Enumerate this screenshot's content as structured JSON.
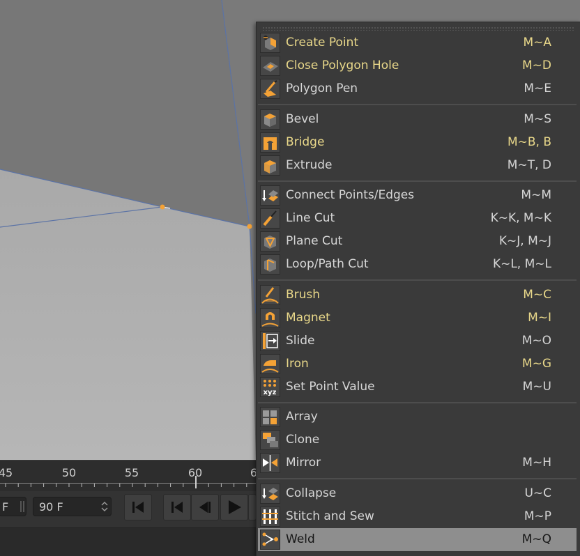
{
  "colors": {
    "accent_orange": "#f4a236",
    "highlight_text": "#e9d88a",
    "menu_bg": "#3a3a3a",
    "selected_bg": "#8e8e8e",
    "edge_blue": "#5b73a6"
  },
  "timeline": {
    "ticks": [
      "45",
      "50",
      "55",
      "60",
      "6"
    ]
  },
  "transport": {
    "start_suffix": "F",
    "end_frame": "90 F"
  },
  "menu": {
    "items": [
      {
        "label": "Create Point",
        "shortcut": "M~A",
        "icon": "create-point-icon",
        "highlight": true
      },
      {
        "label": "Close Polygon Hole",
        "shortcut": "M~D",
        "icon": "close-polygon-hole-icon",
        "highlight": true
      },
      {
        "label": "Polygon Pen",
        "shortcut": "M~E",
        "icon": "polygon-pen-icon",
        "highlight": false
      },
      {
        "label": "Bevel",
        "shortcut": "M~S",
        "icon": "bevel-icon",
        "highlight": false
      },
      {
        "label": "Bridge",
        "shortcut": "M~B, B",
        "icon": "bridge-icon",
        "highlight": true
      },
      {
        "label": "Extrude",
        "shortcut": "M~T, D",
        "icon": "extrude-icon",
        "highlight": false
      },
      {
        "label": "Connect Points/Edges",
        "shortcut": "M~M",
        "icon": "connect-points-icon",
        "highlight": false
      },
      {
        "label": "Line Cut",
        "shortcut": "K~K, M~K",
        "icon": "line-cut-icon",
        "highlight": false
      },
      {
        "label": "Plane Cut",
        "shortcut": "K~J, M~J",
        "icon": "plane-cut-icon",
        "highlight": false
      },
      {
        "label": "Loop/Path Cut",
        "shortcut": "K~L, M~L",
        "icon": "loop-path-cut-icon",
        "highlight": false
      },
      {
        "label": "Brush",
        "shortcut": "M~C",
        "icon": "brush-icon",
        "highlight": true
      },
      {
        "label": "Magnet",
        "shortcut": "M~I",
        "icon": "magnet-icon",
        "highlight": true
      },
      {
        "label": "Slide",
        "shortcut": "M~O",
        "icon": "slide-icon",
        "highlight": false
      },
      {
        "label": "Iron",
        "shortcut": "M~G",
        "icon": "iron-icon",
        "highlight": true
      },
      {
        "label": "Set Point Value",
        "shortcut": "M~U",
        "icon": "set-point-value-icon",
        "highlight": false
      },
      {
        "label": "Array",
        "shortcut": "",
        "icon": "array-icon",
        "highlight": false
      },
      {
        "label": "Clone",
        "shortcut": "",
        "icon": "clone-icon",
        "highlight": false
      },
      {
        "label": "Mirror",
        "shortcut": "M~H",
        "icon": "mirror-icon",
        "highlight": false
      },
      {
        "label": "Collapse",
        "shortcut": "U~C",
        "icon": "collapse-icon",
        "highlight": false
      },
      {
        "label": "Stitch and Sew",
        "shortcut": "M~P",
        "icon": "stitch-and-sew-icon",
        "highlight": false
      },
      {
        "label": "Weld",
        "shortcut": "M~Q",
        "icon": "weld-icon",
        "highlight": false,
        "selected": true
      }
    ]
  }
}
